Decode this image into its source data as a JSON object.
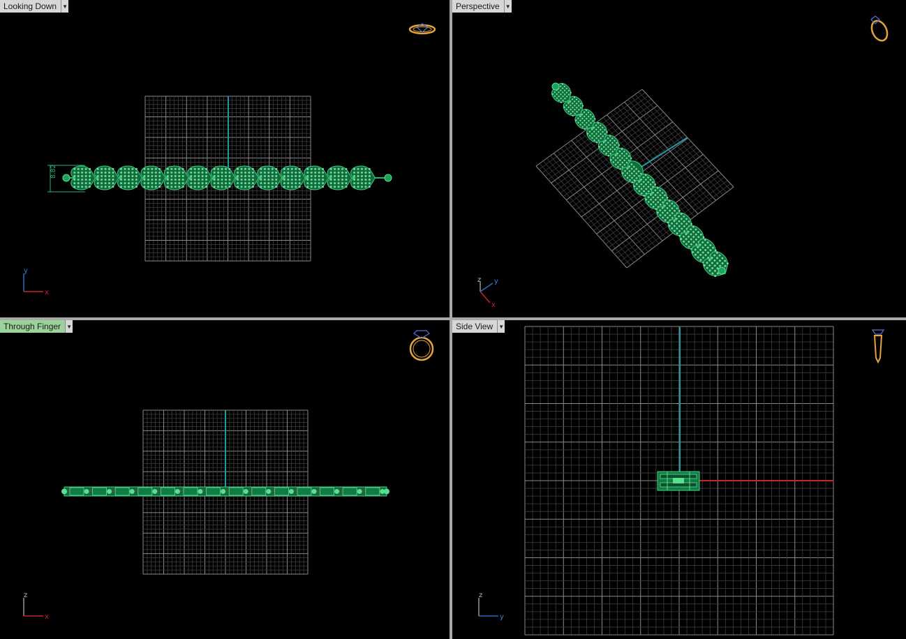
{
  "viewports": [
    {
      "id": "top-left",
      "tab_label": "Looking Down",
      "active": false,
      "axis_labels": [
        "y",
        "x"
      ],
      "icon": "ring-top-icon"
    },
    {
      "id": "top-right",
      "tab_label": "Perspective",
      "active": false,
      "axis_labels": [
        "z",
        "y",
        "x"
      ],
      "icon": "ring-perspective-icon"
    },
    {
      "id": "bottom-left",
      "tab_label": "Through Finger",
      "active": true,
      "axis_labels": [
        "z",
        "x"
      ],
      "icon": "ring-front-icon"
    },
    {
      "id": "bottom-right",
      "tab_label": "Side View",
      "active": false,
      "axis_labels": [
        "z",
        "y"
      ],
      "icon": "ring-side-icon"
    }
  ],
  "dimension_label": "8.82",
  "dropdown_glyph": "▼",
  "colors": {
    "viewport_bg": "#000000",
    "grid": "#6e6e6e",
    "axis_green": "#1f9aa0",
    "axis_red": "#c0282c",
    "bracelet": "#1aa35c",
    "bracelet_highlight": "#59e08e",
    "ring_icon": "#e2a43c",
    "ring_gem": "#5a6fd6",
    "active_tab": "#9bd39b"
  }
}
